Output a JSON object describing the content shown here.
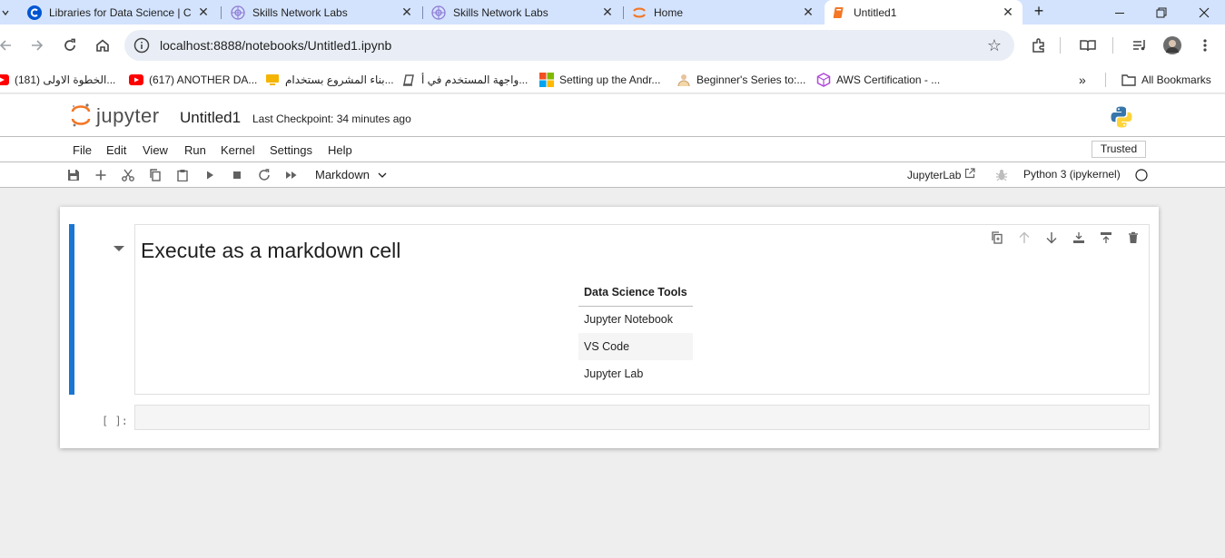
{
  "browser": {
    "tabs": [
      {
        "title": "Libraries for Data Science | C",
        "icon": "coursera-icon",
        "active": false
      },
      {
        "title": "Skills Network Labs",
        "icon": "skills-network-icon",
        "active": false
      },
      {
        "title": "Skills Network Labs",
        "icon": "skills-network-icon",
        "active": false
      },
      {
        "title": "Home",
        "icon": "jupyter-icon",
        "active": false
      },
      {
        "title": "Untitled1",
        "icon": "notebook-icon",
        "active": true
      }
    ],
    "url": "localhost:8888/notebooks/Untitled1.ipynb",
    "bookmarks": [
      {
        "label": "(181) الخطوة الاولى...",
        "icon": "youtube-icon"
      },
      {
        "label": "(617) ANOTHER DA...",
        "icon": "youtube-icon"
      },
      {
        "label": "بناء المشروع بستخدام...",
        "icon": "bookmark-icon"
      },
      {
        "label": "واجهة المستخدم في أ...",
        "icon": "bookmark-icon"
      },
      {
        "label": "Setting up the Andr...",
        "icon": "microsoft-icon"
      },
      {
        "label": "Beginner's Series to:...",
        "icon": "bookmark-icon"
      },
      {
        "label": "AWS Certification - ...",
        "icon": "aws-icon"
      }
    ],
    "all_bookmarks": "All Bookmarks"
  },
  "jupyter": {
    "logo_text": "jupyter",
    "notebook_title": "Untitled1",
    "checkpoint": "Last Checkpoint: 34 minutes ago",
    "menu": [
      "File",
      "Edit",
      "View",
      "Run",
      "Kernel",
      "Settings",
      "Help"
    ],
    "trusted": "Trusted",
    "cell_type": "Markdown",
    "jupyterlab_link": "JupyterLab",
    "kernel_name": "Python 3 (ipykernel)"
  },
  "cell": {
    "heading": "Execute as a markdown cell",
    "table": {
      "header": "Data Science Tools",
      "rows": [
        "Jupyter Notebook",
        "VS Code",
        "Jupyter Lab"
      ]
    }
  },
  "code_cell": {
    "prompt": "[ ]:"
  },
  "colors": {
    "tab_strip": "#d3e3fd",
    "cell_selected_bar": "#1976d2",
    "jupyter_orange": "#f37726"
  }
}
